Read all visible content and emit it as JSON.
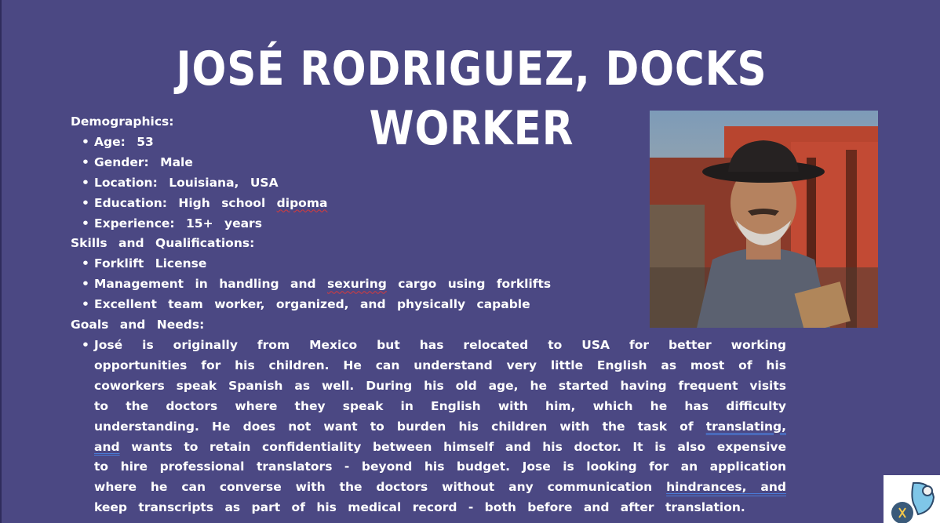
{
  "title": "JOSÉ RODRIGUEZ, DOCKS WORKER",
  "demographics": {
    "heading": "Demographics:",
    "items": [
      {
        "label": "Age:",
        "value": "53"
      },
      {
        "label": "Gender:",
        "value": "Male"
      },
      {
        "label": "Location:",
        "value": "Louisiana, USA"
      },
      {
        "label": "Education:",
        "value": "High school",
        "misspelled": "dipoma"
      },
      {
        "label": "Experience:",
        "value": "15+ years"
      }
    ]
  },
  "skills": {
    "heading": "Skills and Qualifications:",
    "item1": "Forklift License",
    "item2_pre": "Management in handling and",
    "item2_err": "sexuring",
    "item2_post": "cargo using forklifts",
    "item3": "Excellent team worker, organized, and physically capable"
  },
  "goals": {
    "heading": "Goals and Needs:",
    "p1": "José is originally from Mexico but has relocated to USA for better working opportunities for his children. He can understand very little English as most of his coworkers speak Spanish as well. During his old age, he started having frequent visits to the doctors where they speak in English with him, which he has difficulty understanding. He does not want to burden his children with the task of",
    "u1": "translating, and",
    "p2": "wants to retain confidentiality between himself and his doctor. It is also expensive to hire professional translators - beyond his budget. Jose is looking for an application where he can converse with the doctors without any communication",
    "u2": "hindrances, and",
    "p3": "keep transcripts as part of his medical record - both before and after translation."
  },
  "icons": {
    "photo": "portrait-photo",
    "logo": "translation-app-logo-icon"
  },
  "colors": {
    "background": "#4b4883",
    "text": "#ffffff",
    "spellcheck": "#d93a3a",
    "grammar": "#4a7bd8"
  }
}
